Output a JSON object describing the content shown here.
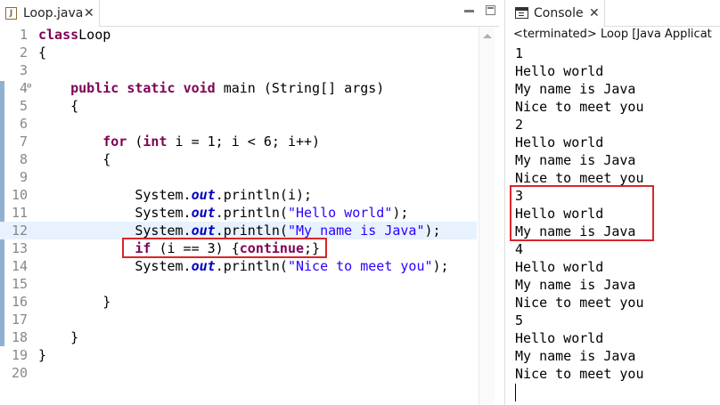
{
  "editor": {
    "tab_label": "Loop.java",
    "tab_icon_glyph": "J",
    "tab_close": "✕",
    "lines": [
      {
        "n": "1",
        "html_tokens": [
          [
            "kw",
            "class"
          ],
          [
            "",
            "Loop"
          ]
        ]
      },
      {
        "n": "2",
        "html_tokens": [
          [
            "",
            "{"
          ]
        ]
      },
      {
        "n": "3",
        "html_tokens": []
      },
      {
        "n": "4",
        "html_tokens": [
          [
            "",
            "    "
          ],
          [
            "kw",
            "public"
          ],
          [
            "",
            " "
          ],
          [
            "kw",
            "static"
          ],
          [
            "",
            " "
          ],
          [
            "kw",
            "void"
          ],
          [
            "",
            " main (String[] args)"
          ]
        ],
        "fold": "⊖"
      },
      {
        "n": "5",
        "html_tokens": [
          [
            "",
            "    {"
          ]
        ]
      },
      {
        "n": "6",
        "html_tokens": []
      },
      {
        "n": "7",
        "html_tokens": [
          [
            "",
            "        "
          ],
          [
            "kw",
            "for"
          ],
          [
            "",
            " ("
          ],
          [
            "kw",
            "int"
          ],
          [
            "",
            " i = 1; i < 6; i++)"
          ]
        ]
      },
      {
        "n": "8",
        "html_tokens": [
          [
            "",
            "        {"
          ]
        ]
      },
      {
        "n": "9",
        "html_tokens": []
      },
      {
        "n": "10",
        "html_tokens": [
          [
            "",
            "            System."
          ],
          [
            "fld",
            "out"
          ],
          [
            "",
            ".println(i);"
          ]
        ]
      },
      {
        "n": "11",
        "html_tokens": [
          [
            "",
            "            System."
          ],
          [
            "fld",
            "out"
          ],
          [
            "",
            ".println("
          ],
          [
            "str",
            "\"Hello world\""
          ],
          [
            "",
            ");"
          ]
        ]
      },
      {
        "n": "12",
        "html_tokens": [
          [
            "",
            "            System."
          ],
          [
            "fld",
            "out"
          ],
          [
            "",
            ".println("
          ],
          [
            "str",
            "\"My name is Java\""
          ],
          [
            "",
            ");"
          ]
        ],
        "highlighted": true
      },
      {
        "n": "13",
        "html_tokens": [
          [
            "",
            "            "
          ],
          [
            "kw",
            "if"
          ],
          [
            "",
            " (i == 3) {"
          ],
          [
            "kw",
            "continue"
          ],
          [
            "",
            ";}"
          ]
        ]
      },
      {
        "n": "14",
        "html_tokens": [
          [
            "",
            "            System."
          ],
          [
            "fld",
            "out"
          ],
          [
            "",
            ".println("
          ],
          [
            "str",
            "\"Nice to meet you\""
          ],
          [
            "",
            ");"
          ]
        ]
      },
      {
        "n": "15",
        "html_tokens": []
      },
      {
        "n": "16",
        "html_tokens": [
          [
            "",
            "        }"
          ]
        ]
      },
      {
        "n": "17",
        "html_tokens": []
      },
      {
        "n": "18",
        "html_tokens": [
          [
            "",
            "    }"
          ]
        ]
      },
      {
        "n": "19",
        "html_tokens": [
          [
            "",
            "}"
          ]
        ]
      },
      {
        "n": "20",
        "html_tokens": []
      }
    ]
  },
  "console": {
    "tab_label": "Console",
    "tab_close": "✕",
    "status": "<terminated> Loop [Java Applicat",
    "output": [
      "1",
      "Hello world",
      "My name is Java",
      "Nice to meet you",
      "2",
      "Hello world",
      "My name is Java",
      "Nice to meet you",
      "3",
      "Hello world",
      "My name is Java",
      "4",
      "Hello world",
      "My name is Java",
      "Nice to meet you",
      "5",
      "Hello world",
      "My name is Java",
      "Nice to meet you"
    ]
  },
  "colors": {
    "keyword": "#7f0055",
    "field": "#0000c0",
    "string": "#2a00ff",
    "annotation_box": "#d9262b",
    "line_highlight": "#e8f2fe"
  }
}
